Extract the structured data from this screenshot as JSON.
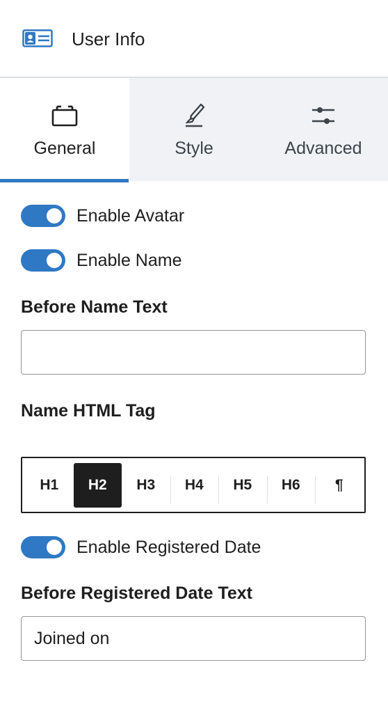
{
  "header": {
    "title": "User Info",
    "icon": "user-card-icon"
  },
  "tabs": [
    {
      "label": "General",
      "icon": "card-icon",
      "active": true
    },
    {
      "label": "Style",
      "icon": "brush-icon",
      "active": false
    },
    {
      "label": "Advanced",
      "icon": "sliders-icon",
      "active": false
    }
  ],
  "toggles": {
    "avatar": {
      "label": "Enable Avatar",
      "on": true
    },
    "name": {
      "label": "Enable Name",
      "on": true
    },
    "registered_date": {
      "label": "Enable Registered Date",
      "on": true
    }
  },
  "before_name": {
    "label": "Before Name Text",
    "value": "",
    "placeholder": ""
  },
  "name_tag": {
    "label": "Name HTML Tag",
    "options": [
      "H1",
      "H2",
      "H3",
      "H4",
      "H5",
      "H6",
      "¶"
    ],
    "selected": "H2"
  },
  "before_date": {
    "label": "Before Registered Date Text",
    "value": "Joined on"
  },
  "colors": {
    "accent": "#2f78c4",
    "text": "#1e1e1e",
    "tab_bg": "#f0f2f5"
  }
}
